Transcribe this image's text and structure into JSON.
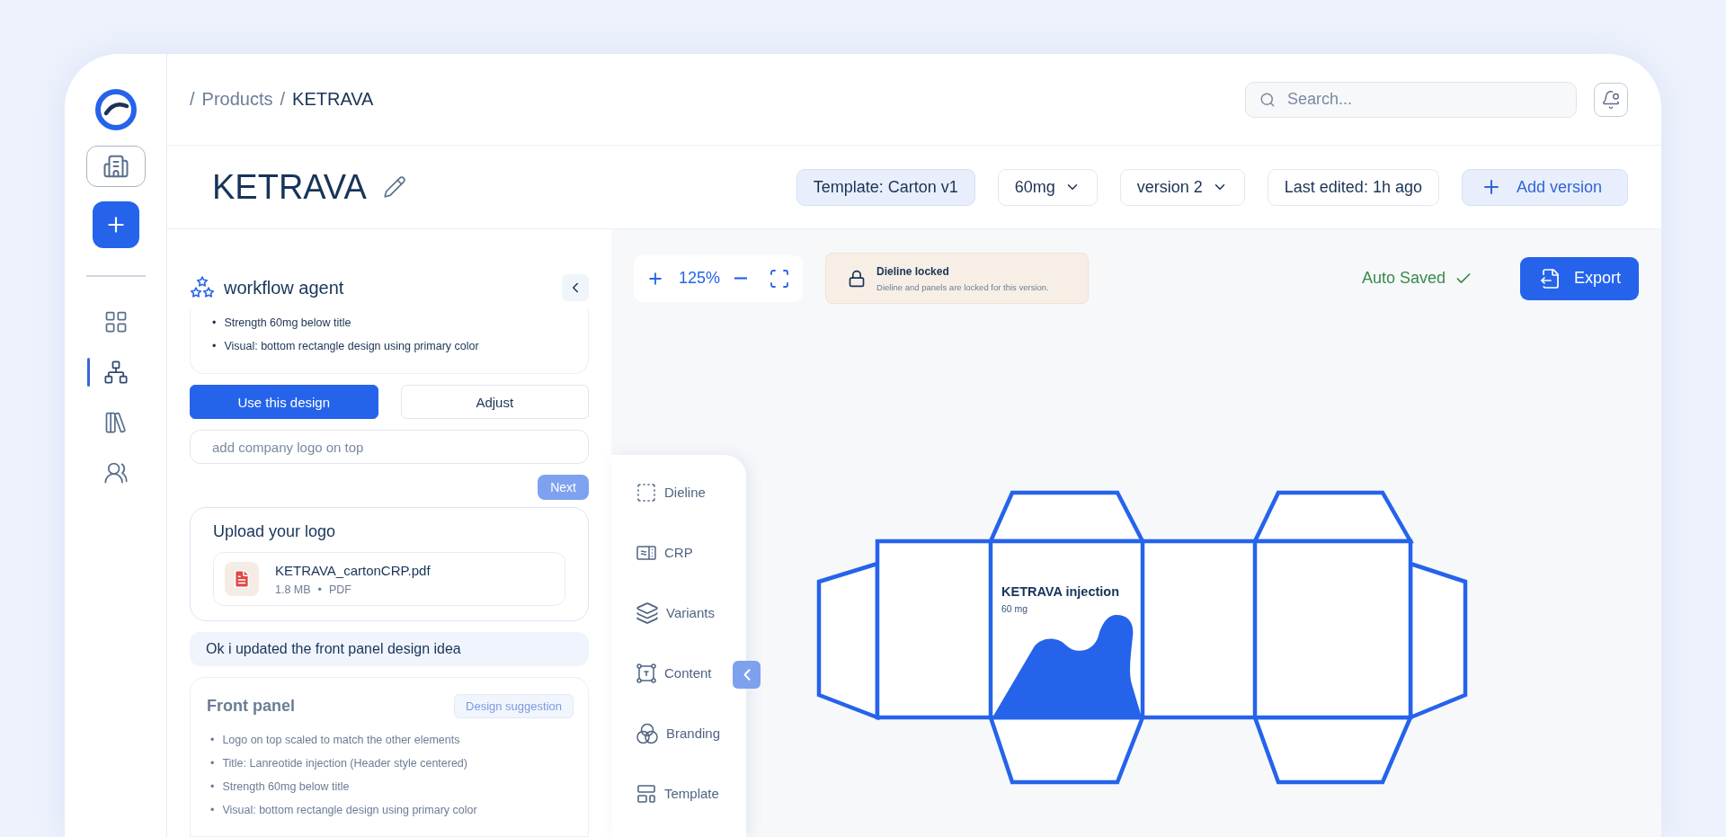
{
  "rail": {
    "nav": [
      {
        "kind": "grid",
        "selected": false
      },
      {
        "kind": "nodes",
        "selected": true
      },
      {
        "kind": "library",
        "selected": false
      },
      {
        "kind": "people",
        "selected": false
      }
    ]
  },
  "breadcrumb": [
    {
      "separator": "/",
      "label": "Products",
      "current": false
    },
    {
      "separator": "/",
      "label": "KETRAVA",
      "current": true
    }
  ],
  "search": {
    "placeholder": "Search..."
  },
  "title": "KETRAVA",
  "chips": [
    {
      "kind": "tag",
      "label": "Template: Carton v1"
    },
    {
      "kind": "dropdown",
      "label": "60mg"
    },
    {
      "kind": "dropdown",
      "label": "version 2"
    },
    {
      "kind": "info",
      "label": "Last edited: 1h ago"
    },
    {
      "kind": "add",
      "label": "Add version"
    }
  ],
  "agent": {
    "title": "workflow agent",
    "previous_card": {
      "marker": "•",
      "bullets": [
        "Strength 60mg below title",
        "Visual: bottom rectangle design using primary color"
      ]
    },
    "buttons": [
      {
        "kind": "primary",
        "label": "Use this design"
      },
      {
        "kind": "secondary",
        "label": "Adjust"
      }
    ],
    "input": {
      "placeholder": "add company logo on top"
    },
    "next": {
      "label": "Next",
      "disabled": true
    },
    "upload": {
      "title": "Upload your logo",
      "file": {
        "name": "KETRAVA_cartonCRP.pdf",
        "size": "1.8 MB",
        "separator": "•",
        "type": "PDF"
      }
    },
    "message": "Ok i updated the front panel design idea",
    "suggestion": {
      "title": "Front panel",
      "badge": "Design suggestion",
      "marker": "•",
      "bullets": [
        "Logo on top scaled to match the other elements",
        "Title: Lanreotide injection (Header style centered)",
        "Strength 60mg below title",
        "Visual: bottom rectangle design using primary color"
      ]
    }
  },
  "canvas": {
    "zoom": "125%",
    "lock": {
      "title": "Dieline locked",
      "text": "Dieline and panels are locked for this version."
    },
    "status": "Auto Saved",
    "export": "Export",
    "tools": [
      {
        "kind": "dieline",
        "label": "Dieline"
      },
      {
        "kind": "crp",
        "label": "CRP"
      },
      {
        "kind": "variants",
        "label": "Variants"
      },
      {
        "kind": "content",
        "label": "Content"
      },
      {
        "kind": "branding",
        "label": "Branding"
      },
      {
        "kind": "template",
        "label": "Template"
      }
    ],
    "front_panel": {
      "title": "KETRAVA injection",
      "strength": "60 mg"
    }
  }
}
